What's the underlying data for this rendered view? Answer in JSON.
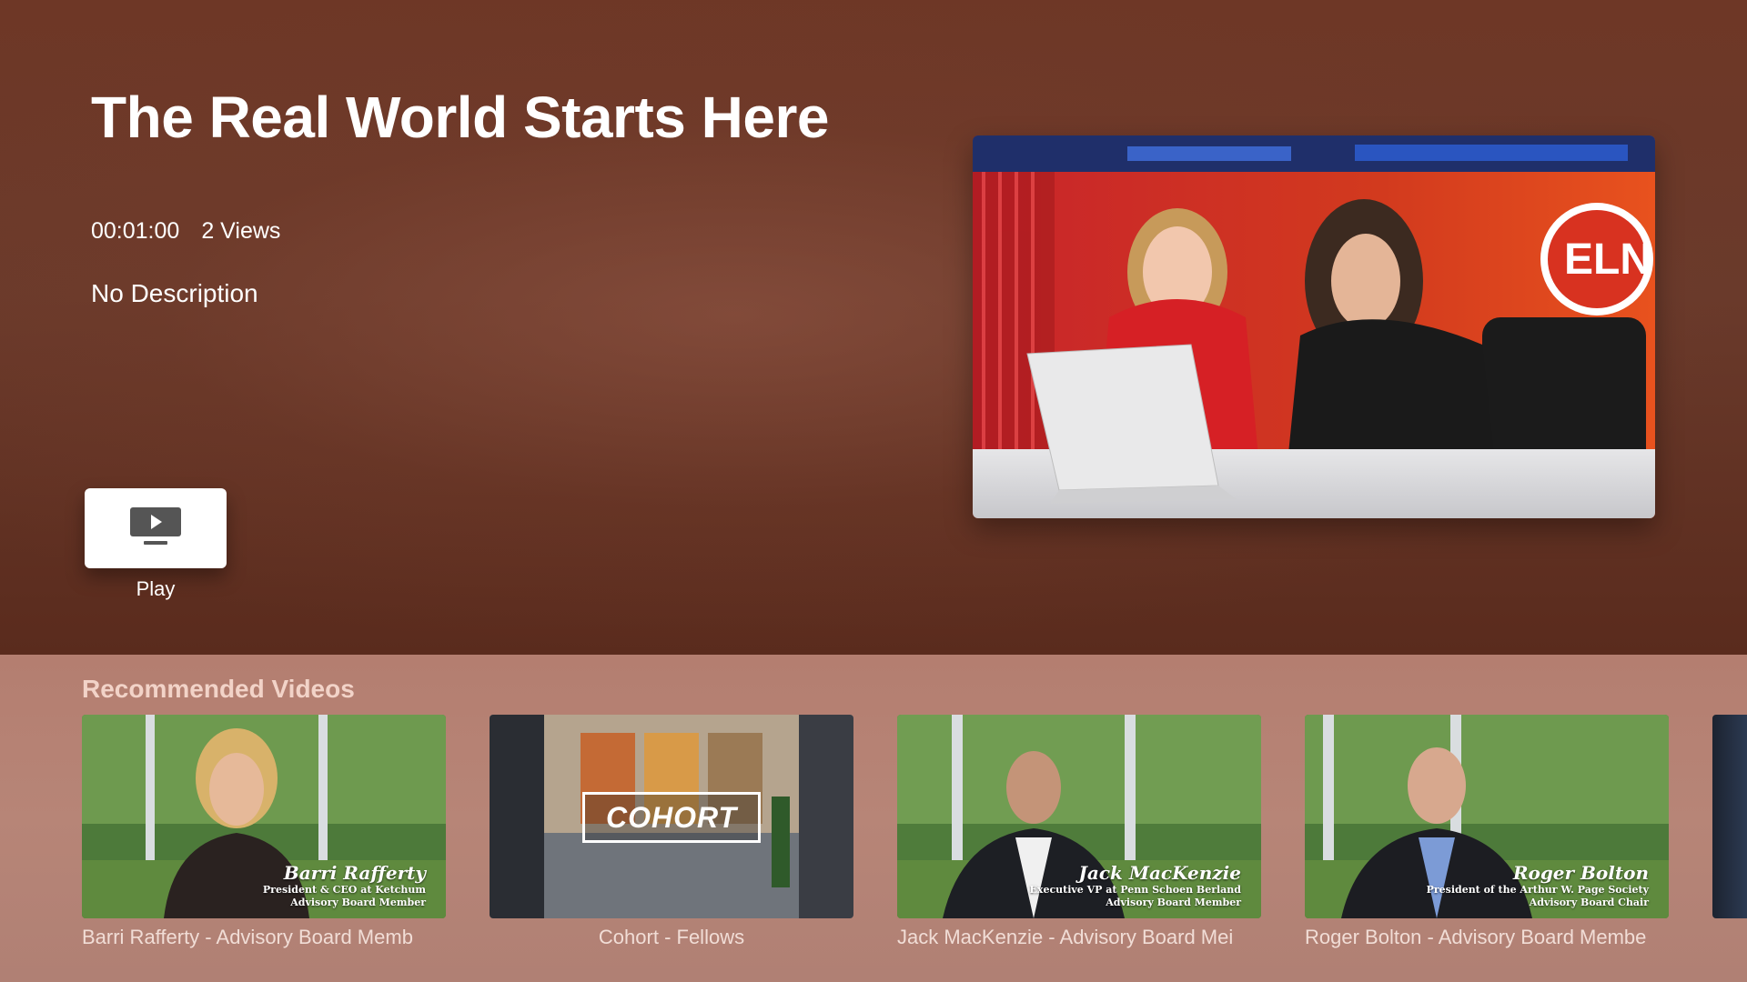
{
  "video": {
    "title": "The Real World Starts Here",
    "duration": "00:01:00",
    "views": "2 Views",
    "description": "No Description",
    "play_label": "Play"
  },
  "hero_thumbnail": {
    "logo_text": "ELN"
  },
  "recommended": {
    "heading": "Recommended Videos",
    "items": [
      {
        "caption": "Barri Rafferty - Advisory Board Memb",
        "overlay_name": "Barri Rafferty",
        "overlay_role1": "President & CEO at Ketchum",
        "overlay_role2": "Advisory Board Member"
      },
      {
        "caption": "Cohort - Fellows",
        "overlay_text": "COHORT"
      },
      {
        "caption": "Jack MacKenzie - Advisory Board Mei",
        "overlay_name": "Jack MacKenzie",
        "overlay_role1": "Executive VP at Penn Schoen Berland",
        "overlay_role2": "Advisory Board Member"
      },
      {
        "caption": "Roger Bolton - Advisory Board Membe",
        "overlay_name": "Roger Bolton",
        "overlay_role1": "President of the Arthur W. Page Society",
        "overlay_role2": "Advisory Board Chair"
      }
    ]
  },
  "colors": {
    "hero_bg": "#6a3a2b",
    "shelf_bg": "#b78577",
    "shelf_heading": "#f2d3c8",
    "play_button_bg": "#ffffff"
  },
  "icons": {
    "play": "tv-play-icon"
  }
}
